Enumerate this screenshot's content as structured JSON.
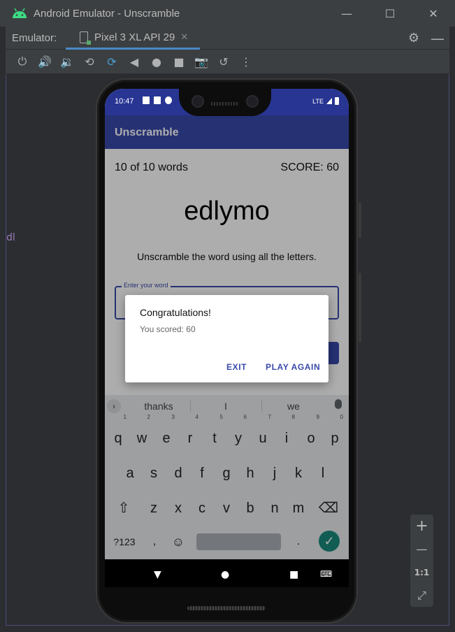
{
  "window": {
    "title": "Android Emulator - Unscramble",
    "minimize": "—",
    "maximize": "☐",
    "close": "✕"
  },
  "tabbar": {
    "emulator_label": "Emulator:",
    "tab_label": "Pixel 3 XL API 29",
    "tab_close": "✕",
    "settings": "⚙",
    "hide": "—"
  },
  "toolbar": {
    "icons": [
      "power-icon",
      "volume-up-icon",
      "volume-down-icon",
      "rotate-left-icon",
      "rotate-right-icon",
      "back-icon",
      "home-icon",
      "overview-icon",
      "screenshot-icon",
      "snapshot-icon",
      "more-icon"
    ],
    "glyphs": [
      "⏻",
      "🔊",
      "🔉",
      "⟲",
      "⟳",
      "◀",
      "●",
      "■",
      "📷",
      "↺",
      "⋮"
    ]
  },
  "left_strip": "dl",
  "status_bar": {
    "time": "10:47",
    "network": "LTE"
  },
  "app": {
    "title": "Unscramble",
    "word_count": "10 of 10 words",
    "score": "SCORE: 60",
    "scrambled_word": "edlymo",
    "instructions": "Unscramble the word using all the letters.",
    "input_label": "Enter your word",
    "input_value": ""
  },
  "dialog": {
    "title": "Congratulations!",
    "message": "You scored: 60",
    "exit": "EXIT",
    "play_again": "PLAY AGAIN"
  },
  "keyboard": {
    "suggest_arrow": "›",
    "suggestions": [
      "thanks",
      "I",
      "we"
    ],
    "row1": [
      "q",
      "w",
      "e",
      "r",
      "t",
      "y",
      "u",
      "i",
      "o",
      "p"
    ],
    "row1_hints": [
      "1",
      "2",
      "3",
      "4",
      "5",
      "6",
      "7",
      "8",
      "9",
      "0"
    ],
    "row2": [
      "a",
      "s",
      "d",
      "f",
      "g",
      "h",
      "j",
      "k",
      "l"
    ],
    "row3": [
      "z",
      "x",
      "c",
      "v",
      "b",
      "n",
      "m"
    ],
    "shift": "⇧",
    "backspace": "⌫",
    "symbols": "?123",
    "comma": ",",
    "emoji": "☺",
    "period": ".",
    "enter": "✓"
  },
  "navbar": {
    "back": "▼",
    "home": "●",
    "recents": "■",
    "keyboard_switch": "⌨"
  },
  "zoom": {
    "in": "+",
    "out": "—",
    "actual": "1:1",
    "fit": "⤢"
  }
}
